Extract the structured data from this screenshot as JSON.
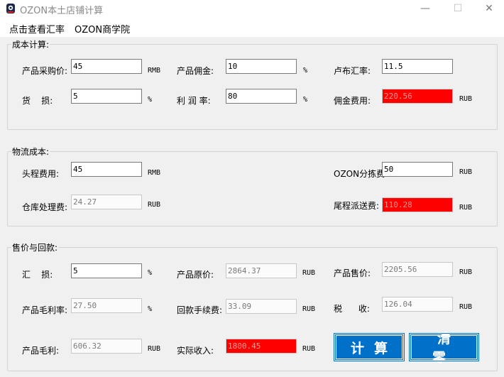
{
  "window": {
    "title": "OZON本土店铺计算",
    "minimize_glyph": "—",
    "maximize_glyph": "☐",
    "close_glyph": "✕",
    "icon": "ozon-app-icon"
  },
  "menu": {
    "items": [
      "点击查看汇率",
      "OZON商学院"
    ]
  },
  "cost": {
    "legend": "成本计算:",
    "purchase_label": "产品采购价:",
    "purchase_value": "45",
    "purchase_unit": "RMB",
    "commission_label": "产品佣金:",
    "commission_value": "10",
    "commission_unit": "%",
    "rate_label": "卢布汇率:",
    "rate_value": "11.5",
    "loss_label": "货    损:",
    "loss_value": "5",
    "loss_unit": "%",
    "profit_label": "利 润 率:",
    "profit_value": "80",
    "profit_unit": "%",
    "commission_fee_label": "佣金费用:",
    "commission_fee_value": "220.56",
    "commission_fee_unit": "RUB"
  },
  "logistics": {
    "legend": "物流成本:",
    "first_leg_label": "头程费用:",
    "first_leg_value": "45",
    "first_leg_unit": "RMB",
    "sort_label": "OZON分拣费:",
    "sort_value": "50",
    "sort_unit": "RUB",
    "warehouse_label": "仓库处理费:",
    "warehouse_value": "24.27",
    "warehouse_unit": "RUB",
    "last_mile_label": "尾程派送费:",
    "last_mile_value": "110.28",
    "last_mile_unit": "RUB"
  },
  "sales": {
    "legend": "售价与回款:",
    "fx_loss_label": "汇    损:",
    "fx_loss_value": "5",
    "fx_loss_unit": "%",
    "original_price_label": "产品原价:",
    "original_price_value": "2864.37",
    "original_price_unit": "RUB",
    "sale_price_label": "产品售价:",
    "sale_price_value": "2205.56",
    "sale_price_unit": "RUB",
    "gross_rate_label": "产品毛利率:",
    "gross_rate_value": "27.50",
    "gross_rate_unit": "%",
    "payback_fee_label": "回款手续费:",
    "payback_fee_value": "33.09",
    "payback_fee_unit": "RUB",
    "tax_label": "税      收:",
    "tax_value": "126.04",
    "tax_unit": "RUB",
    "gross_label": "产品毛利:",
    "gross_value": "606.32",
    "gross_unit": "RUB",
    "income_label": "实际收入:",
    "income_value": "1800.45",
    "income_unit": "RUB"
  },
  "buttons": {
    "calculate": "计算",
    "clear": "清零"
  },
  "colors": {
    "accent_blue": "#0070c8",
    "highlight_red": "#ff0000"
  }
}
